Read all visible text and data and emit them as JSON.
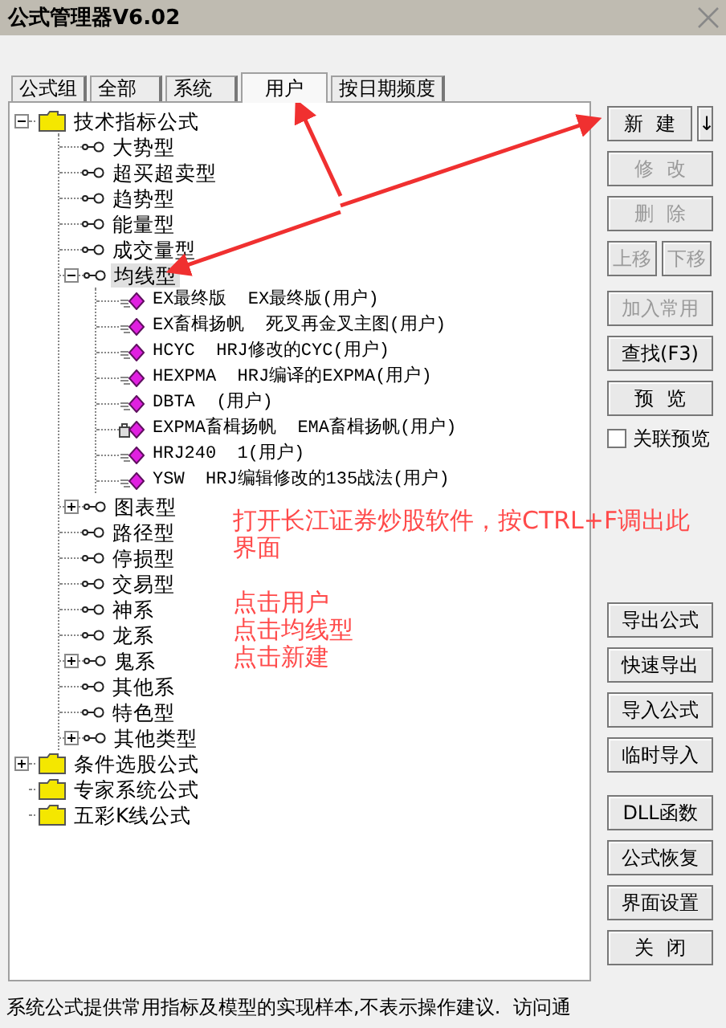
{
  "window": {
    "title": "公式管理器V6.02"
  },
  "tabs": [
    {
      "label": "公式组",
      "selected": false
    },
    {
      "label": "全部",
      "selected": false
    },
    {
      "label": "系统",
      "selected": false
    },
    {
      "label": "用户",
      "selected": true
    },
    {
      "label": "按日期频度",
      "selected": false
    }
  ],
  "tree": [
    {
      "kind": "folder",
      "label": "技术指标公式",
      "expanded": true,
      "selected": false,
      "children": [
        {
          "kind": "group",
          "label": "大势型",
          "selected": false
        },
        {
          "kind": "group",
          "label": "超买超卖型",
          "selected": false
        },
        {
          "kind": "group",
          "label": "趋势型",
          "selected": false
        },
        {
          "kind": "group",
          "label": "能量型",
          "selected": false
        },
        {
          "kind": "group",
          "label": "成交量型",
          "selected": false
        },
        {
          "kind": "group",
          "label": "均线型",
          "expanded": true,
          "selected": true,
          "children": [
            {
              "kind": "formula",
              "label": "EX最终版  EX最终版(用户)",
              "locked": false,
              "selected": false
            },
            {
              "kind": "formula",
              "label": "EX畜楫扬帆  死叉再金叉主图(用户)",
              "locked": false,
              "selected": false
            },
            {
              "kind": "formula",
              "label": "HCYC  HRJ修改的CYC(用户)",
              "locked": false,
              "selected": false
            },
            {
              "kind": "formula",
              "label": "HEXPMA  HRJ编译的EXPMA(用户)",
              "locked": false,
              "selected": false
            },
            {
              "kind": "formula",
              "label": "DBTA  (用户)",
              "locked": false,
              "selected": false
            },
            {
              "kind": "formula",
              "label": "EXPMA畜楫扬帆  EMA畜楫扬帆(用户)",
              "locked": true,
              "selected": false
            },
            {
              "kind": "formula",
              "label": "HRJ240  1(用户)",
              "locked": false,
              "selected": false
            },
            {
              "kind": "formula",
              "label": "YSW  HRJ编辑修改的135战法(用户)",
              "locked": false,
              "selected": false
            }
          ]
        },
        {
          "kind": "group",
          "label": "图表型",
          "expanded": false,
          "selected": false
        },
        {
          "kind": "group",
          "label": "路径型",
          "selected": false
        },
        {
          "kind": "group",
          "label": "停损型",
          "selected": false
        },
        {
          "kind": "group",
          "label": "交易型",
          "selected": false
        },
        {
          "kind": "group",
          "label": "神系",
          "selected": false
        },
        {
          "kind": "group",
          "label": "龙系",
          "selected": false
        },
        {
          "kind": "group",
          "label": "鬼系",
          "expanded": false,
          "selected": false
        },
        {
          "kind": "group",
          "label": "其他系",
          "selected": false
        },
        {
          "kind": "group",
          "label": "特色型",
          "selected": false
        },
        {
          "kind": "group",
          "label": "其他类型",
          "expanded": false,
          "selected": false
        }
      ]
    },
    {
      "kind": "folder",
      "label": "条件选股公式",
      "expanded": false,
      "selected": false
    },
    {
      "kind": "folder",
      "label": "专家系统公式",
      "selected": false
    },
    {
      "kind": "folder",
      "label": "五彩K线公式",
      "selected": false
    }
  ],
  "button_groups": [
    {
      "items": [
        {
          "kind": "split",
          "label": "新  建",
          "menu": "↓",
          "disabled": false
        },
        {
          "kind": "button",
          "label": "修  改",
          "disabled": true
        },
        {
          "kind": "button",
          "label": "删  除",
          "disabled": true
        },
        {
          "kind": "pair",
          "buttons": [
            {
              "label": "上移",
              "disabled": true
            },
            {
              "label": "下移",
              "disabled": true
            }
          ]
        }
      ]
    },
    {
      "items": [
        {
          "kind": "button",
          "label": "加入常用",
          "disabled": true
        },
        {
          "kind": "button",
          "label": "查找(F3)",
          "disabled": false
        },
        {
          "kind": "button",
          "label": "预  览",
          "disabled": false
        },
        {
          "kind": "checkbox",
          "label": "关联预览",
          "checked": false
        }
      ]
    },
    {
      "items": [
        {
          "kind": "button",
          "label": "导出公式",
          "disabled": false
        },
        {
          "kind": "button",
          "label": "快速导出",
          "disabled": false
        },
        {
          "kind": "button",
          "label": "导入公式",
          "disabled": false
        },
        {
          "kind": "button",
          "label": "临时导入",
          "disabled": false
        }
      ]
    },
    {
      "items": [
        {
          "kind": "button",
          "label": "DLL函数",
          "disabled": false
        },
        {
          "kind": "button",
          "label": "公式恢复",
          "disabled": false
        },
        {
          "kind": "button",
          "label": "界面设置",
          "disabled": false
        },
        {
          "kind": "button",
          "label": "关  闭",
          "disabled": false
        }
      ]
    }
  ],
  "status_bar": "系统公式提供常用指标及模型的实现样本,不表示操作建议.  访问通",
  "annotation": {
    "paragraphs": [
      [
        "打开长江证券炒股软件，按CTRL+F调出此",
        "界面"
      ],
      [
        "点击用户",
        "点击均线型",
        "点击新建"
      ]
    ]
  }
}
